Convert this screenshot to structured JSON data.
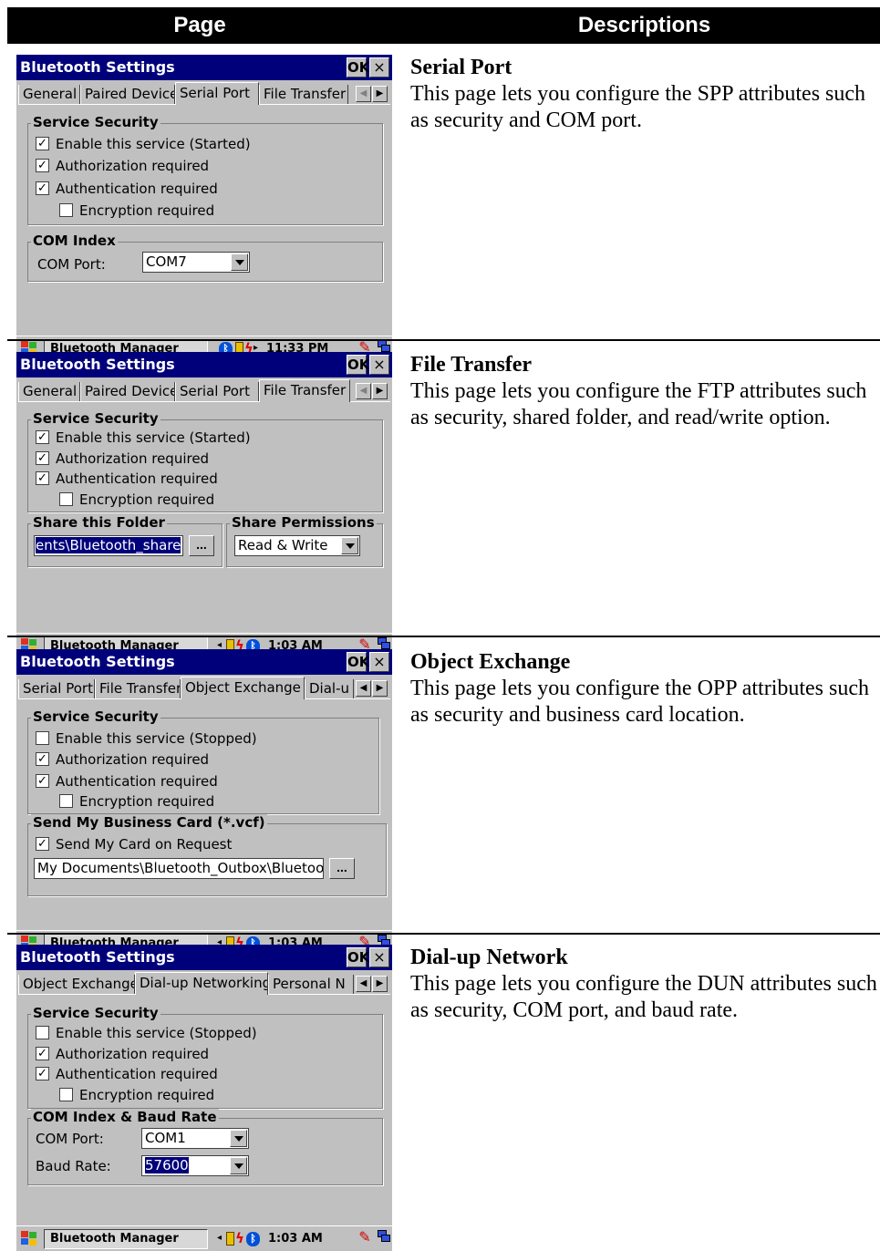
{
  "header": {
    "page": "Page",
    "descriptions": "Descriptions"
  },
  "rows": [
    {
      "title": "Serial Port",
      "text": "This page lets you configure the SPP attributes such as security and COM port.",
      "screen": {
        "window_title": "Bluetooth Settings",
        "ok": "OK",
        "close": "×",
        "tabs": [
          "General",
          "Paired Device",
          "Serial Port",
          "File Transfer"
        ],
        "group1": "Service Security",
        "checks": [
          "Enable this service (Started)",
          "Authorization required",
          "Authentication required",
          "Encryption required"
        ],
        "group2": "COM Index",
        "com_label": "COM Port:",
        "com_value": "COM7",
        "taskbar": "Bluetooth Manager",
        "clock": "11:33 PM"
      }
    },
    {
      "title": "File Transfer",
      "text": "This page lets you configure the FTP attributes such as security, shared folder, and read/write option.",
      "screen": {
        "window_title": "Bluetooth Settings",
        "ok": "OK",
        "close": "×",
        "tabs": [
          "General",
          "Paired Device",
          "Serial Port",
          "File Transfer"
        ],
        "group1": "Service Security",
        "checks": [
          "Enable this service (Started)",
          "Authorization required",
          "Authentication required",
          "Encryption required"
        ],
        "group2": "Share this Folder",
        "folder_value": "ents\\Bluetooth_share",
        "browse": "...",
        "group3": "Share Permissions",
        "perm_value": "Read & Write",
        "taskbar": "Bluetooth Manager",
        "clock": "1:03 AM"
      }
    },
    {
      "title": "Object Exchange",
      "text": "This page lets you configure the OPP attributes such as security and business card location.",
      "screen": {
        "window_title": "Bluetooth Settings",
        "ok": "OK",
        "close": "×",
        "tabs": [
          "Serial Port",
          "File Transfer",
          "Object Exchange",
          "Dial-u"
        ],
        "group1": "Service Security",
        "checks": [
          "Enable this service (Stopped)",
          "Authorization required",
          "Authentication required",
          "Encryption required"
        ],
        "group2": "Send My Business Card (*.vcf)",
        "send_card": "Send My Card on Request",
        "card_path": "My Documents\\Bluetooth_Outbox\\Bluetooth",
        "browse": "...",
        "taskbar": "Bluetooth Manager",
        "clock": "1:03 AM"
      }
    },
    {
      "title": "Dial-up Network",
      "text": "This page lets you configure the DUN attributes such as security, COM port, and baud rate.",
      "screen": {
        "window_title": "Bluetooth Settings",
        "ok": "OK",
        "close": "×",
        "tabs": [
          "Object Exchange",
          "Dial-up Networking",
          "Personal N"
        ],
        "group1": "Service Security",
        "checks": [
          "Enable this service (Stopped)",
          "Authorization required",
          "Authentication required",
          "Encryption required"
        ],
        "group2": "COM Index & Baud Rate",
        "com_label": "COM Port:",
        "com_value": "COM1",
        "baud_label": "Baud Rate:",
        "baud_value": "57600",
        "taskbar": "Bluetooth Manager",
        "clock": "1:03 AM"
      }
    }
  ]
}
